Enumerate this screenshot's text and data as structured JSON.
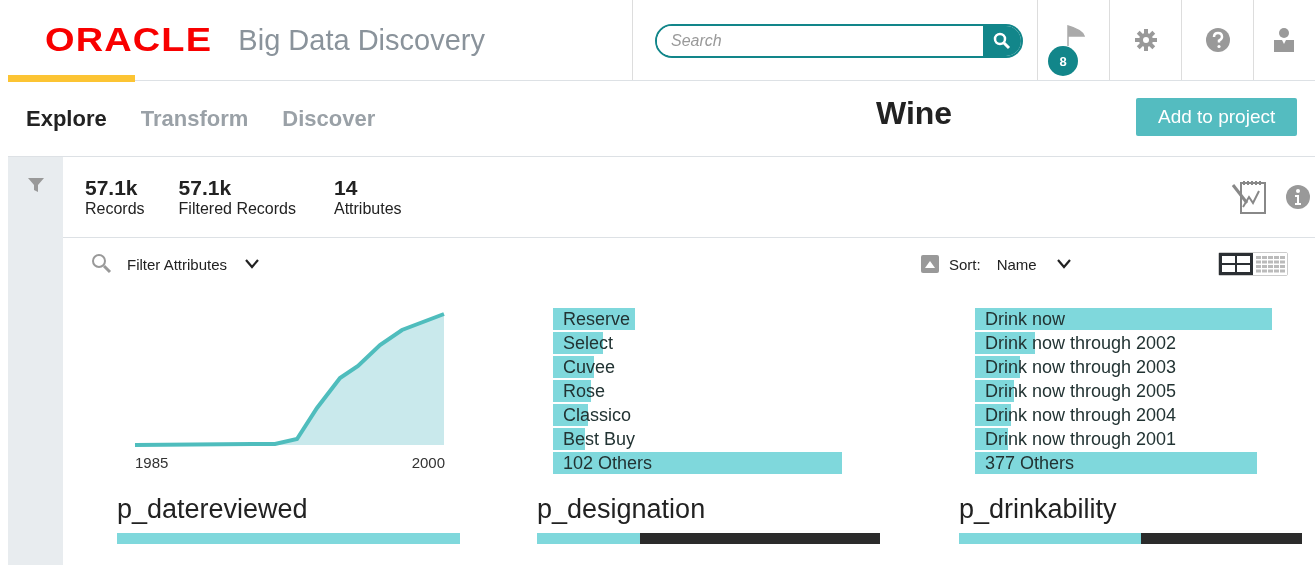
{
  "header": {
    "logo": "ORACLE",
    "product": "Big Data Discovery",
    "search": {
      "placeholder": "Search"
    },
    "notifications": {
      "badge": "8"
    }
  },
  "tabs": [
    {
      "label": "Explore",
      "selected": true
    },
    {
      "label": "Transform",
      "selected": false
    },
    {
      "label": "Discover",
      "selected": false
    }
  ],
  "dataset_title": "Wine",
  "add_button": "Add to project",
  "summary": [
    {
      "value": "57.1k",
      "label": "Records"
    },
    {
      "value": "57.1k",
      "label": "Filtered Records"
    },
    {
      "value": "14",
      "label": "Attributes"
    }
  ],
  "toolbar": {
    "filter": "Filter Attributes",
    "sort_label": "Sort:",
    "sort_value": "Name",
    "views": [
      {
        "kind": "large",
        "selected": true
      },
      {
        "kind": "small",
        "selected": false
      }
    ]
  },
  "cards": [
    {
      "kind": "area",
      "name": "p_datereviewed",
      "x_labels": [
        "1985",
        "2000"
      ],
      "level": 1.0
    },
    {
      "kind": "bars",
      "name": "p_designation",
      "level": 0.3,
      "bars": [
        {
          "label": "Reserve"
        },
        {
          "label": "Select"
        },
        {
          "label": "Cuvee"
        },
        {
          "label": "Rose"
        },
        {
          "label": "Classico"
        },
        {
          "label": "Best Buy"
        },
        {
          "label": "102 Others"
        }
      ]
    },
    {
      "kind": "bars",
      "name": "p_drinkability",
      "level": 0.53,
      "bars": [
        {
          "label": "Drink now"
        },
        {
          "label": "Drink now through 2002"
        },
        {
          "label": "Drink now through 2003"
        },
        {
          "label": "Drink now through 2005"
        },
        {
          "label": "Drink now through 2004"
        },
        {
          "label": "Drink now through 2001"
        },
        {
          "label": "377 Others"
        }
      ]
    }
  ]
}
